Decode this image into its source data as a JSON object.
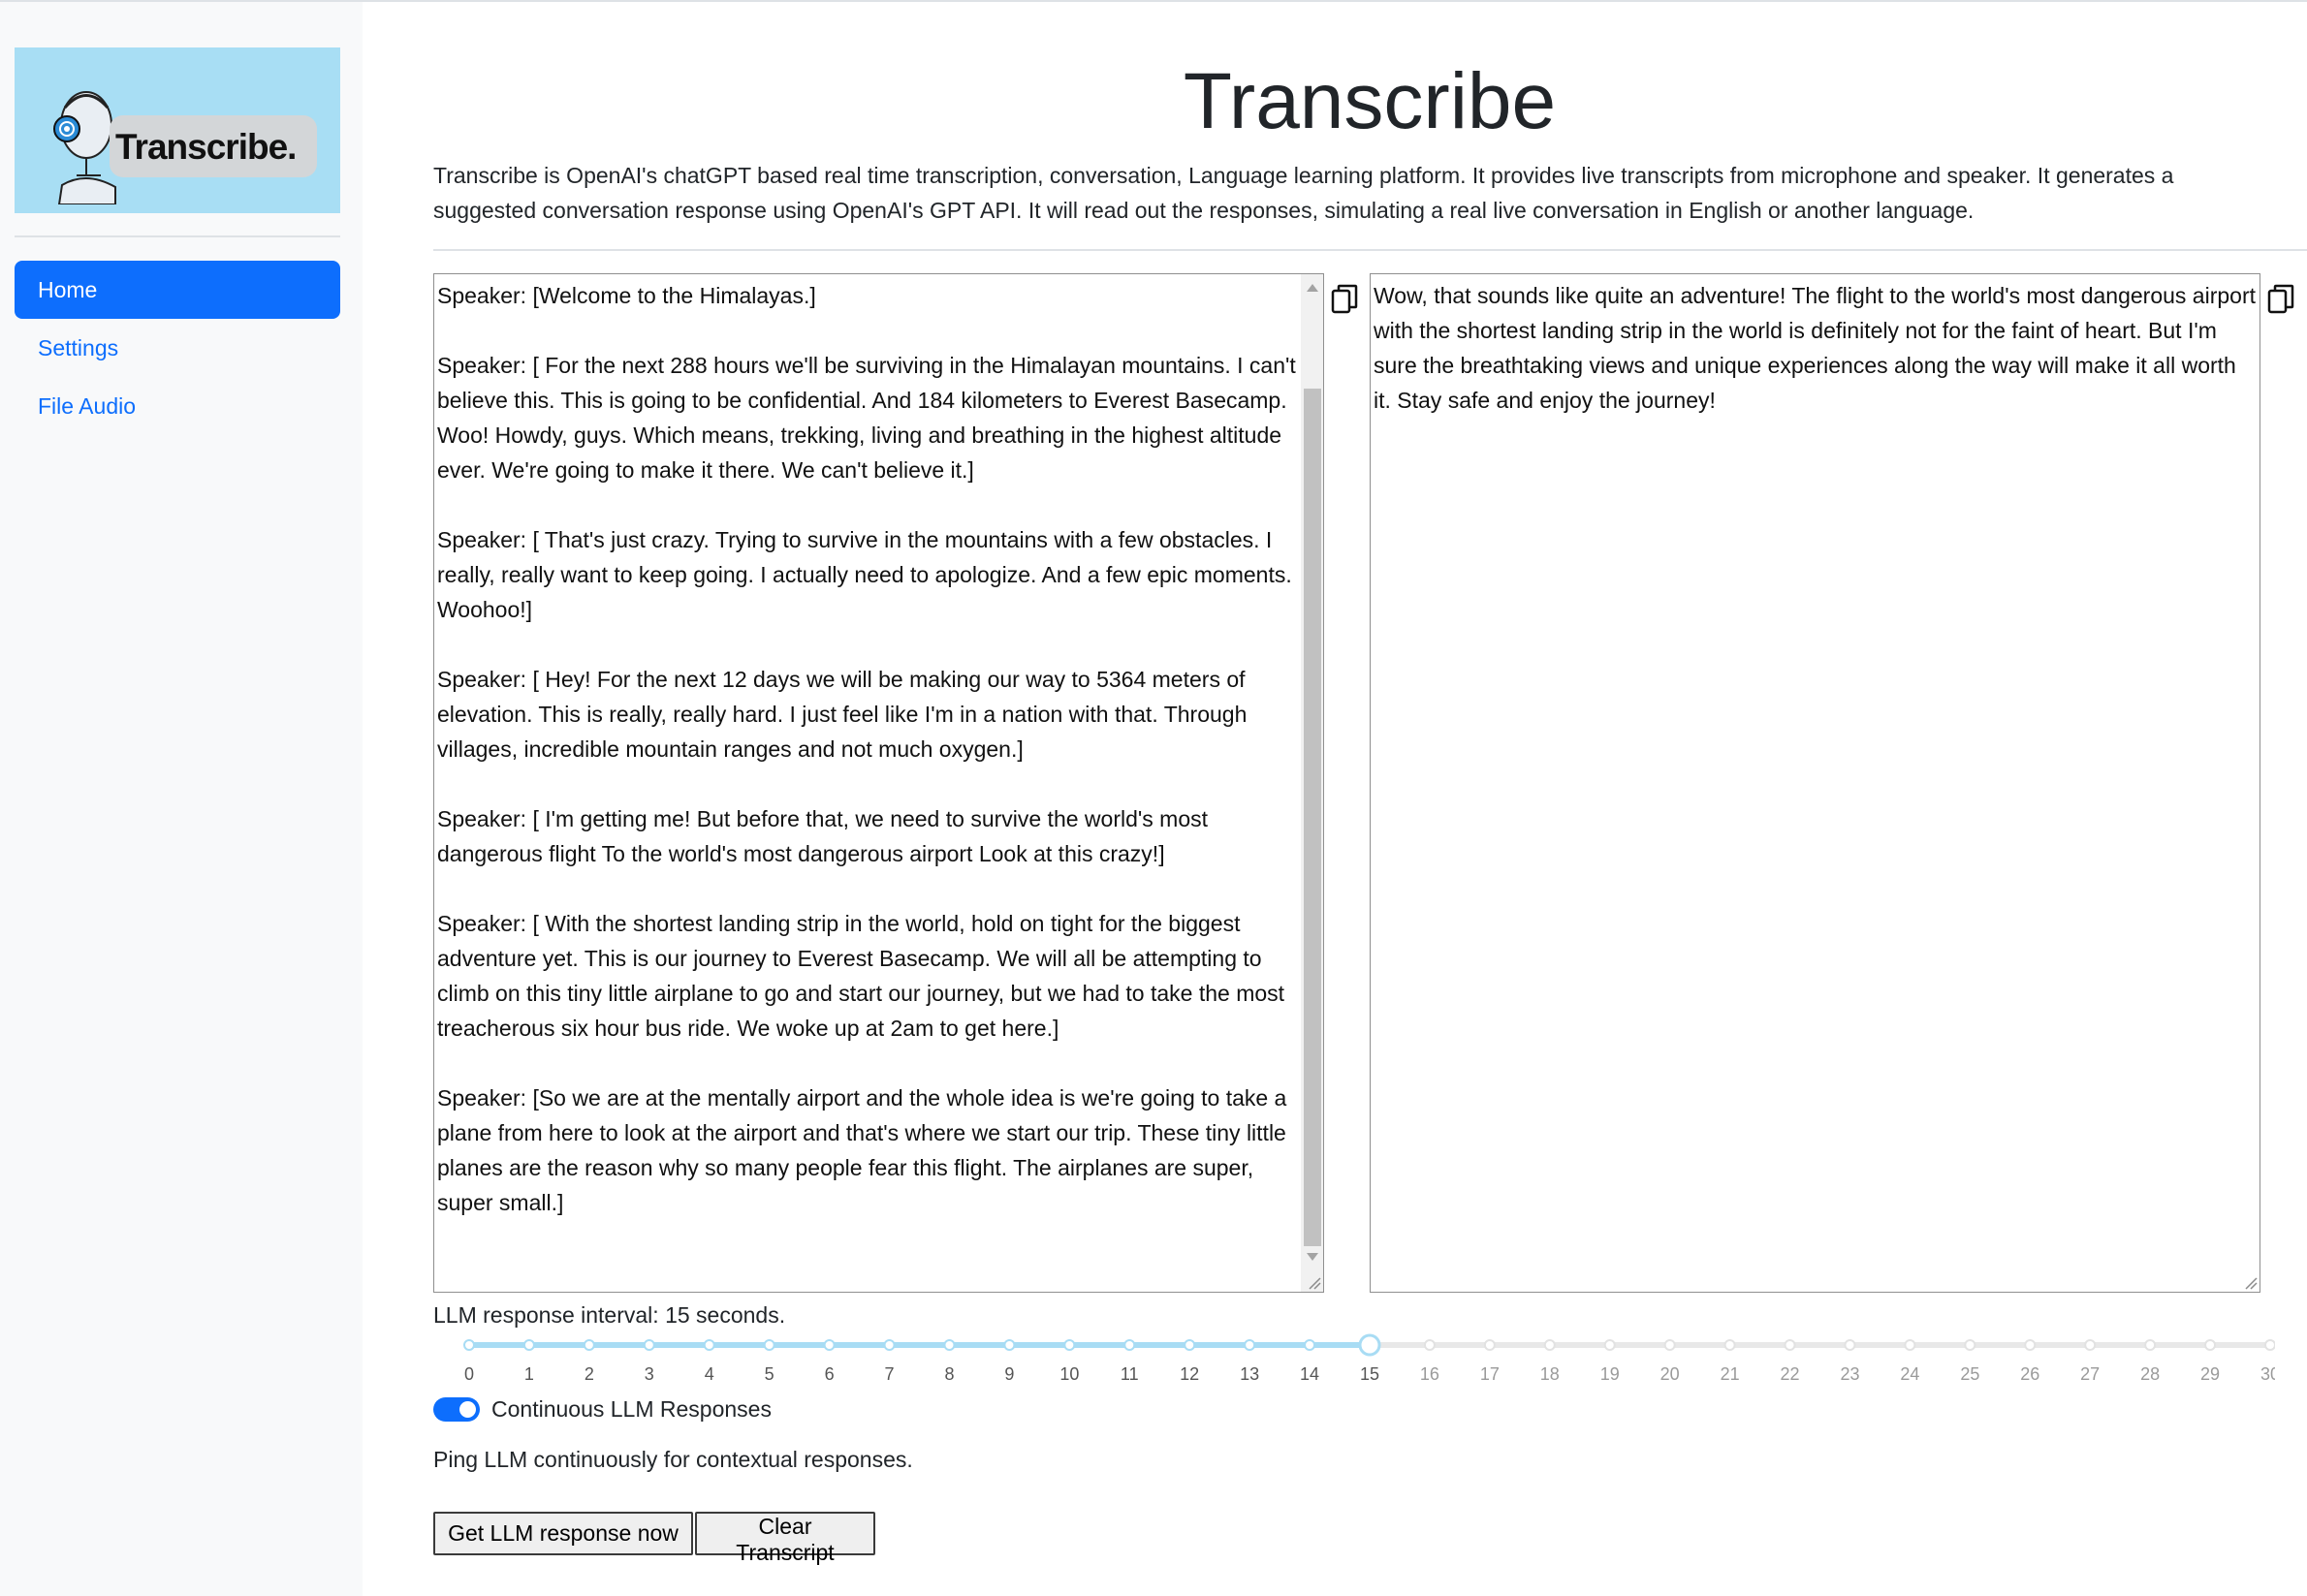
{
  "sidebar": {
    "logo_text": "Transcribe.",
    "nav": [
      {
        "label": "Home",
        "active": true
      },
      {
        "label": "Settings",
        "active": false
      },
      {
        "label": "File Audio",
        "active": false
      }
    ]
  },
  "main": {
    "title": "Transcribe",
    "description": "Transcribe is OpenAI's chatGPT based real time transcription, conversation, Language learning platform. It provides live transcripts from microphone and speaker. It generates a suggested conversation response using OpenAI's GPT API. It will read out the responses, simulating a real live conversation in English or another language.",
    "transcript": "Speaker: [Welcome to the Himalayas.]\n\nSpeaker: [ For the next 288 hours we'll be surviving in the Himalayan mountains. I can't believe this. This is going to be confidential. And 184 kilometers to Everest Basecamp. Woo! Howdy, guys. Which means, trekking, living and breathing in the highest altitude ever. We're going to make it there. We can't believe it.]\n\nSpeaker: [ That's just crazy. Trying to survive in the mountains with a few obstacles. I really, really want to keep going. I actually need to apologize. And a few epic moments. Woohoo!]\n\nSpeaker: [ Hey! For the next 12 days we will be making our way to 5364 meters of elevation. This is really, really hard. I just feel like I'm in a nation with that. Through villages, incredible mountain ranges and not much oxygen.]\n\nSpeaker: [ I'm getting me! But before that, we need to survive the world's most dangerous flight To the world's most dangerous airport Look at this crazy!]\n\nSpeaker: [ With the shortest landing strip in the world, hold on tight for the biggest adventure yet. This is our journey to Everest Basecamp. We will all be attempting to climb on this tiny little airplane to go and start our journey, but we had to take the most treacherous six hour bus ride. We woke up at 2am to get here.]\n\nSpeaker: [So we are at the mentally airport and the whole idea is we're going to take a plane from here to look at the airport and that's where we start our trip. These tiny little planes are the reason why so many people fear this flight. The airplanes are super, super small.]",
    "response": "Wow, that sounds like quite an adventure! The flight to the world's most dangerous airport with the shortest landing strip in the world is definitely not for the faint of heart. But I'm sure the breathtaking views and unique experiences along the way will make it all worth it. Stay safe and enjoy the journey!",
    "interval_label": "LLM response interval: 15 seconds.",
    "slider": {
      "min": 0,
      "max": 30,
      "value": 15
    },
    "toggle_label": "Continuous LLM Responses",
    "toggle_on": true,
    "ping_text": "Ping LLM continuously for contextual responses.",
    "btn_get_response": "Get LLM response now",
    "btn_clear": "Clear Transcript"
  },
  "colors": {
    "accent": "#0d6efd",
    "slider_filled": "#a8dcf4",
    "slider_empty": "#e8e8e8",
    "logo_bg": "#a8def4"
  }
}
